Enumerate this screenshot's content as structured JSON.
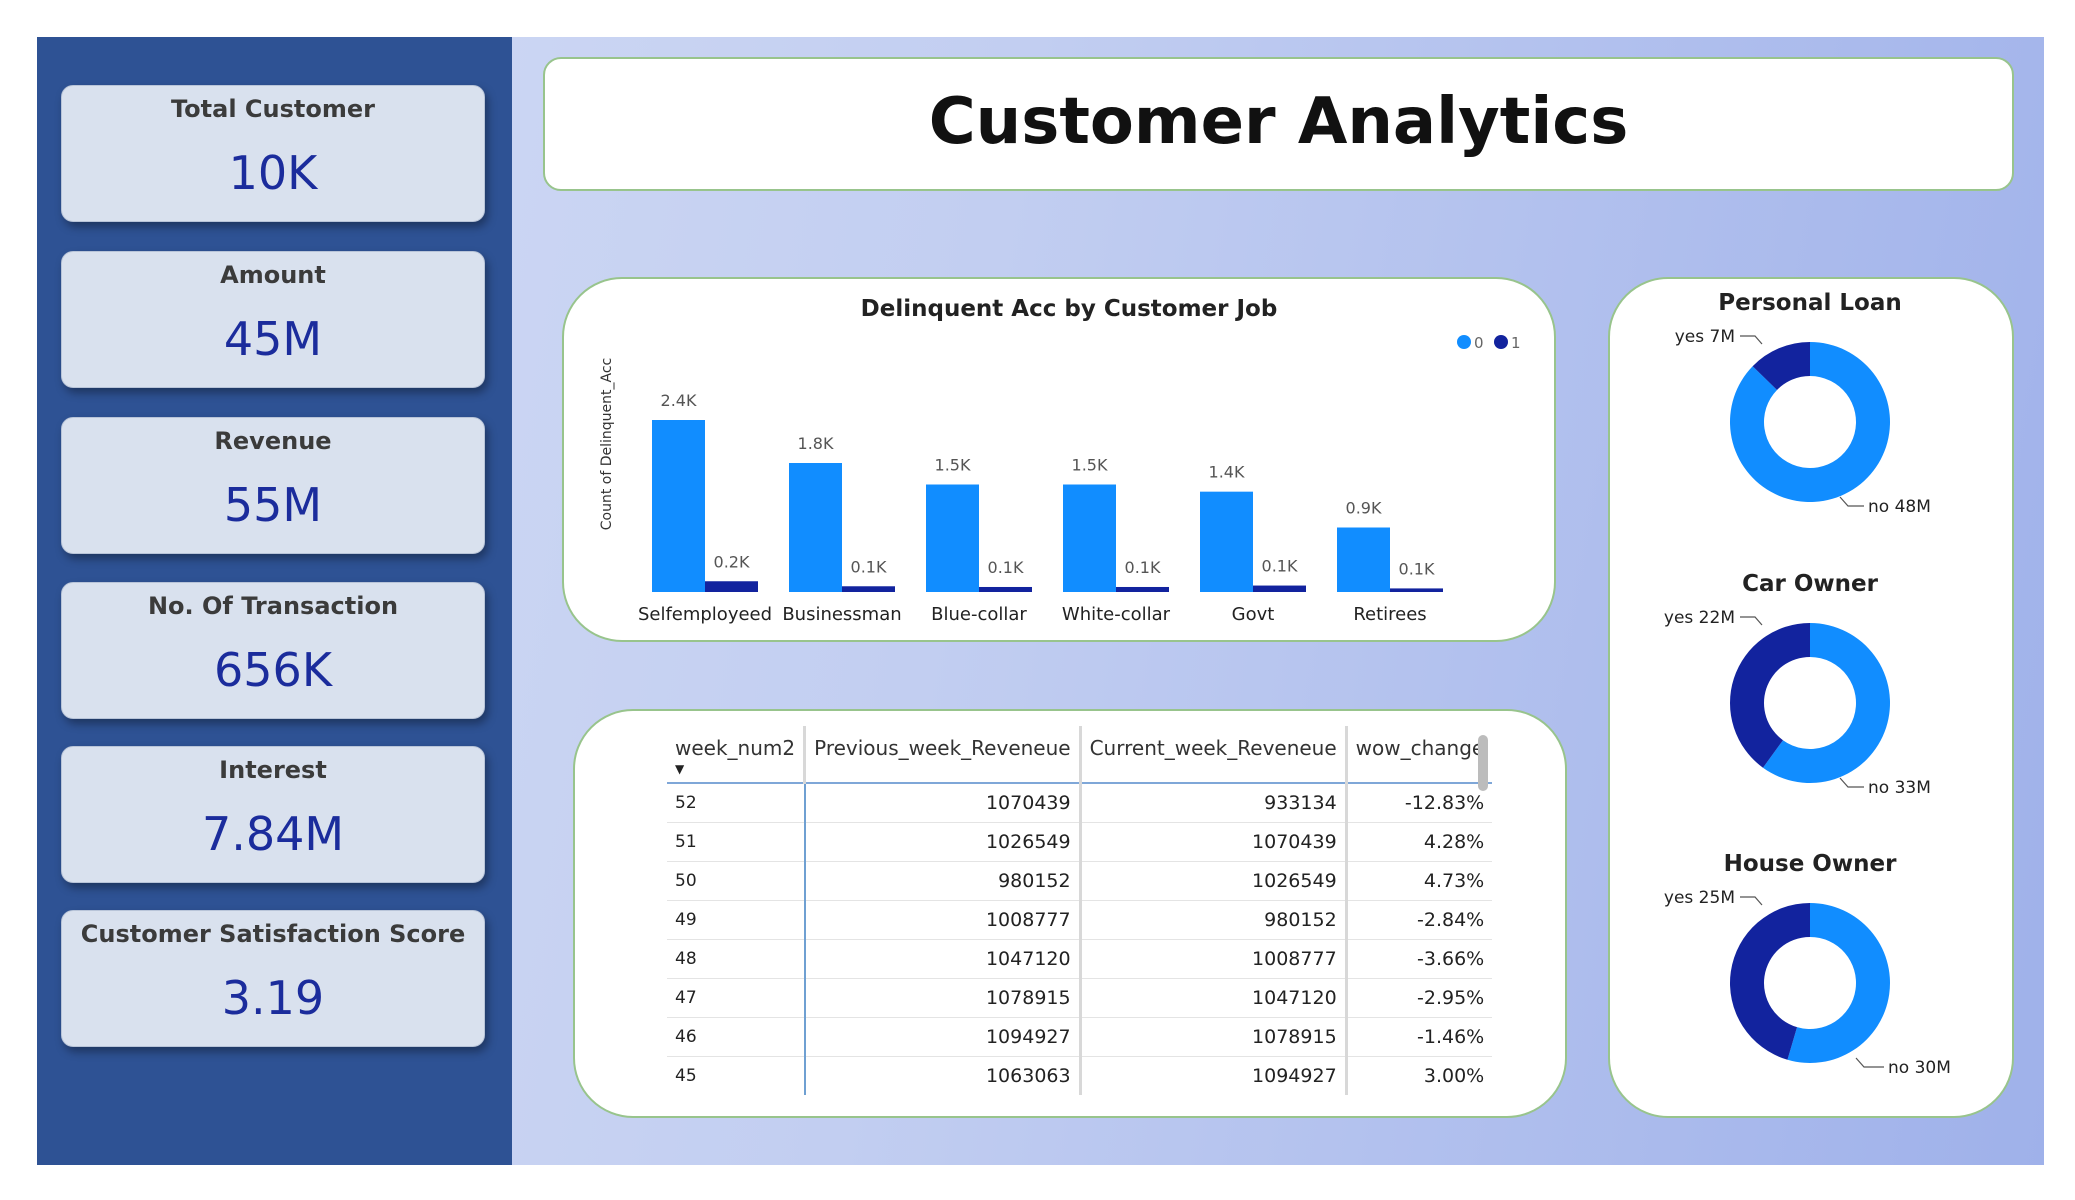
{
  "kpis": [
    {
      "label": "Total Customer",
      "value": "10K"
    },
    {
      "label": "Amount",
      "value": "45M"
    },
    {
      "label": "Revenue",
      "value": "55M"
    },
    {
      "label": "No. Of Transaction",
      "value": "656K"
    },
    {
      "label": "Interest",
      "value": "7.84M"
    },
    {
      "label": "Customer Satisfaction Score",
      "value": "3.19"
    }
  ],
  "title": "Customer Analytics",
  "colors": {
    "series0": "#118dff",
    "series1": "#12239e",
    "sidebar": "#2e5294",
    "panel_border": "#98c48c"
  },
  "chart_data": [
    {
      "type": "bar",
      "title": "Delinquent Acc by Customer Job",
      "ylabel": "Count of Delinquent_Acc",
      "xlabel": "",
      "legend": "top-right",
      "categories": [
        "Selfemployeed",
        "Businessman",
        "Blue-collar",
        "White-collar",
        "Govt",
        "Retirees"
      ],
      "series": [
        {
          "name": "0",
          "values": [
            2400,
            1800,
            1500,
            1500,
            1400,
            900
          ],
          "labels": [
            "2.4K",
            "1.8K",
            "1.5K",
            "1.5K",
            "1.4K",
            "0.9K"
          ]
        },
        {
          "name": "1",
          "values": [
            150,
            80,
            70,
            70,
            90,
            50
          ],
          "labels": [
            "0.2K",
            "0.1K",
            "0.1K",
            "0.1K",
            "0.1K",
            "0.1K"
          ]
        }
      ]
    },
    {
      "type": "pie",
      "title": "Personal Loan",
      "slices": [
        {
          "label": "yes",
          "value": 7,
          "text": "7M"
        },
        {
          "label": "no",
          "value": 48,
          "text": "48M"
        }
      ]
    },
    {
      "type": "pie",
      "title": "Car Owner",
      "slices": [
        {
          "label": "yes",
          "value": 22,
          "text": "22M"
        },
        {
          "label": "no",
          "value": 33,
          "text": "33M"
        }
      ]
    },
    {
      "type": "pie",
      "title": "House Owner",
      "slices": [
        {
          "label": "yes",
          "value": 25,
          "text": "25M"
        },
        {
          "label": "no",
          "value": 30,
          "text": "30M"
        }
      ]
    },
    {
      "type": "table",
      "columns": [
        "week_num2",
        "Previous_week_Reveneue",
        "Current_week_Reveneue",
        "wow_change"
      ],
      "rows": [
        [
          "52",
          "1070439",
          "933134",
          "-12.83%"
        ],
        [
          "51",
          "1026549",
          "1070439",
          "4.28%"
        ],
        [
          "50",
          "980152",
          "1026549",
          "4.73%"
        ],
        [
          "49",
          "1008777",
          "980152",
          "-2.84%"
        ],
        [
          "48",
          "1047120",
          "1008777",
          "-3.66%"
        ],
        [
          "47",
          "1078915",
          "1047120",
          "-2.95%"
        ],
        [
          "46",
          "1094927",
          "1078915",
          "-1.46%"
        ],
        [
          "45",
          "1063063",
          "1094927",
          "3.00%"
        ]
      ]
    }
  ]
}
